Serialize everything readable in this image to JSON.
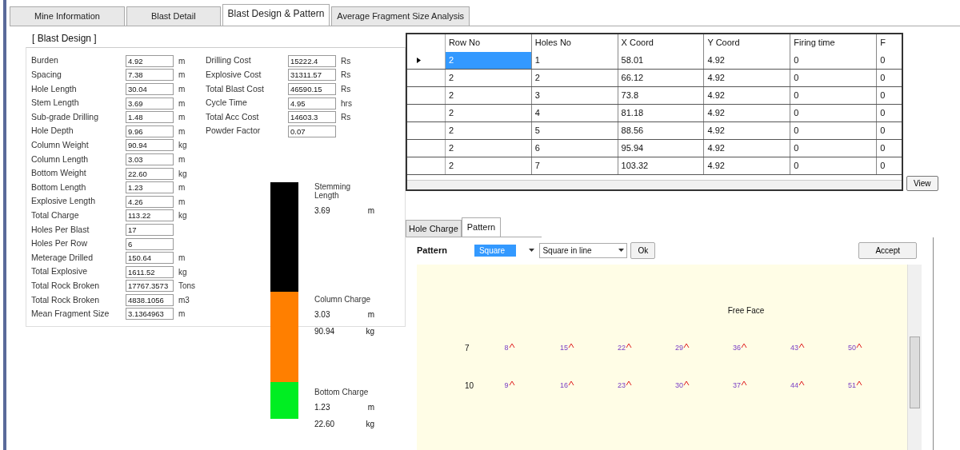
{
  "tabs": [
    {
      "label": "Mine Information",
      "selected": false
    },
    {
      "label": "Blast Detail",
      "selected": false
    },
    {
      "label": "Blast Design & Pattern",
      "selected": true
    },
    {
      "label": "Average Fragment Size Analysis",
      "selected": false
    }
  ],
  "blast_design": {
    "title": "[ Blast Design ]",
    "fields": [
      {
        "label": "Burden",
        "value": "4.92",
        "unit": "m"
      },
      {
        "label": "Spacing",
        "value": "7.38",
        "unit": "m"
      },
      {
        "label": "Hole Length",
        "value": "30.04",
        "unit": "m"
      },
      {
        "label": "Stem Length",
        "value": "3.69",
        "unit": "m"
      },
      {
        "label": "Sub-grade Drilling",
        "value": "1.48",
        "unit": "m"
      },
      {
        "label": "Hole Depth",
        "value": "9.96",
        "unit": "m"
      },
      {
        "label": "Column Weight",
        "value": "90.94",
        "unit": "kg"
      },
      {
        "label": "Column Length",
        "value": "3.03",
        "unit": "m"
      },
      {
        "label": "Bottom Weight",
        "value": "22.60",
        "unit": "kg"
      },
      {
        "label": "Bottom Length",
        "value": "1.23",
        "unit": "m"
      },
      {
        "label": "Explosive Length",
        "value": "4.26",
        "unit": "m"
      },
      {
        "label": "Total Charge",
        "value": "113.22",
        "unit": "kg"
      },
      {
        "label": "Holes Per Blast",
        "value": "17"
      },
      {
        "label": "Holes Per Row",
        "value": "6"
      },
      {
        "label": "Meterage Drilled",
        "value": "150.64",
        "unit": "m"
      },
      {
        "label": "Total Explosive",
        "value": "1611.52",
        "unit": "kg"
      },
      {
        "label": "Total Rock Broken",
        "value": "17767.3573",
        "unit": "Tons"
      },
      {
        "label": "Total Rock Broken",
        "value": "4838.1056",
        "unit": "m3"
      },
      {
        "label": "Mean Fragment Size",
        "value": "3.1364963",
        "unit": "m"
      }
    ],
    "costs": [
      {
        "label": "Drilling Cost",
        "value": "15222.4",
        "unit": "Rs"
      },
      {
        "label": "Explosive Cost",
        "value": "31311.57",
        "unit": "Rs"
      },
      {
        "label": "Total Blast Cost",
        "value": "46590.15",
        "unit": "Rs"
      },
      {
        "label": "Cycle Time",
        "value": "4.95",
        "unit": "hrs"
      },
      {
        "label": "Total Acc Cost",
        "value": "14603.3",
        "unit": "Rs"
      },
      {
        "label": "Powder Factor",
        "value": "0.07"
      }
    ]
  },
  "charge_column": [
    {
      "title": "Stemming Length",
      "length": "3.69",
      "length_unit": "m",
      "color": "#000000"
    },
    {
      "title": "Column Charge",
      "length": "3.03",
      "length_unit": "m",
      "weight": "90.94",
      "weight_unit": "kg",
      "color": "#ff7f00"
    },
    {
      "title": "Bottom Charge",
      "length": "1.23",
      "length_unit": "m",
      "weight": "22.60",
      "weight_unit": "kg",
      "color": "#00ee22"
    }
  ],
  "table": {
    "columns": [
      "Row No",
      "Holes No",
      "X Coord",
      "Y Coord",
      "Firing time",
      "F"
    ],
    "rows": [
      {
        "cells": [
          "2",
          "1",
          "58.01",
          "4.92",
          "0",
          "0"
        ],
        "selected": true
      },
      {
        "cells": [
          "2",
          "2",
          "66.12",
          "4.92",
          "0",
          "0"
        ],
        "selected": false
      },
      {
        "cells": [
          "2",
          "3",
          "73.8",
          "4.92",
          "0",
          "0"
        ],
        "selected": false
      },
      {
        "cells": [
          "2",
          "4",
          "81.18",
          "4.92",
          "0",
          "0"
        ],
        "selected": false
      },
      {
        "cells": [
          "2",
          "5",
          "88.56",
          "4.92",
          "0",
          "0"
        ],
        "selected": false
      },
      {
        "cells": [
          "2",
          "6",
          "95.94",
          "4.92",
          "0",
          "0"
        ],
        "selected": false
      },
      {
        "cells": [
          "2",
          "7",
          "103.32",
          "4.92",
          "0",
          "0"
        ],
        "selected": false
      }
    ]
  },
  "view_button": "View",
  "sub_tabs": [
    {
      "label": "Hole Charge",
      "selected": false
    },
    {
      "label": "Pattern",
      "selected": true
    }
  ],
  "pattern": {
    "label": "Pattern",
    "type_value": "Square",
    "layout_value": "Square in line",
    "ok_button": "Ok",
    "accept_button": "Accept",
    "free_face": "Free Face",
    "rows": [
      {
        "label": "7",
        "holes": [
          "8",
          "15",
          "22",
          "29",
          "36",
          "43",
          "50"
        ]
      },
      {
        "label": "10",
        "holes": [
          "9",
          "16",
          "23",
          "30",
          "37",
          "44",
          "51"
        ]
      }
    ]
  }
}
